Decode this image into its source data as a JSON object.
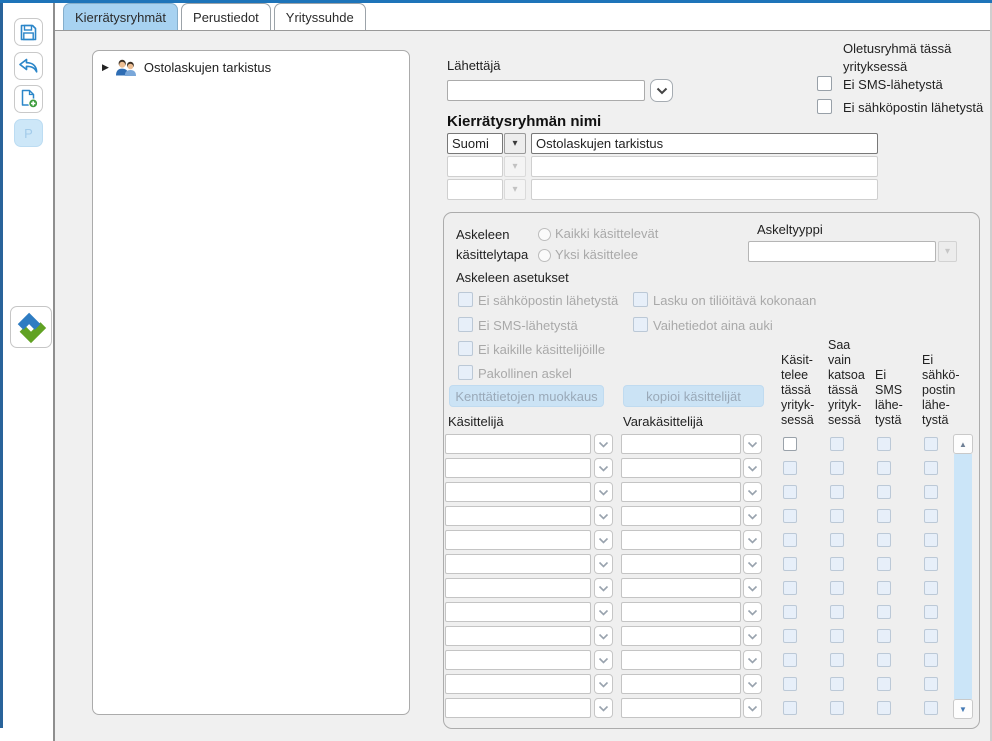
{
  "colors": {
    "accent_blue": "#1E74B9",
    "left_strip_blue": "#29639A",
    "tab_active_blue": "#A7D2F1",
    "panel_button_blue": "#CBE3F5",
    "scrollbar_track_blue": "#CBE5F8",
    "icon_blue": "#2B86C9",
    "logo_green": "#61A223"
  },
  "icons": {
    "save": "floppy-disk",
    "undo": "undo-arrow",
    "new_document": "document-with-plus",
    "logo": "app-logo-interlocked-check",
    "tree_item": "two-people-group",
    "dropdowns": "chevron-down",
    "scroll": "triangle-up-down"
  },
  "sidebar": {
    "p_button_label": "P"
  },
  "tabs": [
    {
      "label": "Kierrätysryhmät",
      "active": true
    },
    {
      "label": "Perustiedot",
      "active": false
    },
    {
      "label": "Yrityssuhde",
      "active": false
    }
  ],
  "tree": {
    "items": [
      {
        "label": "Ostolaskujen tarkistus",
        "expanded": false
      }
    ]
  },
  "form": {
    "sender_label": "Lähettäjä",
    "sender_value": "",
    "default_group_label": "Oletusryhmä tässä\nyrityksessä",
    "default_group_checks": [
      {
        "label": "Ei SMS-lähetystä",
        "checked": false
      },
      {
        "label": "Ei sähköpostin lähetystä",
        "checked": false
      }
    ],
    "group_name_heading": "Kierrätysryhmän nimi",
    "name_rows": [
      {
        "language": "Suomi",
        "value": "Ostolaskujen tarkistus",
        "enabled": true
      },
      {
        "language": "",
        "value": "",
        "enabled": false
      },
      {
        "language": "",
        "value": "",
        "enabled": false
      }
    ]
  },
  "step_panel": {
    "handling_label": "Askeleen\nkäsittelytapa",
    "handling_options": [
      {
        "label": "Kaikki käsittelevät",
        "selected": false
      },
      {
        "label": "Yksi käsittelee",
        "selected": false
      }
    ],
    "step_type_label": "Askeltyyppi",
    "step_type_value": "",
    "settings_label": "Askeleen asetukset",
    "settings_col1": [
      {
        "label": "Ei sähköpostin lähetystä",
        "checked": false,
        "enabled": false
      },
      {
        "label": "Ei SMS-lähetystä",
        "checked": false,
        "enabled": false
      },
      {
        "label": "Ei kaikille käsittelijöille",
        "checked": false,
        "enabled": false
      },
      {
        "label": "Pakollinen askel",
        "checked": false,
        "enabled": false
      }
    ],
    "settings_col2": [
      {
        "label": "Lasku on tiliöitävä kokonaan",
        "checked": false,
        "enabled": false
      },
      {
        "label": "Vaihetiedot aina auki",
        "checked": false,
        "enabled": false
      }
    ],
    "buttons": {
      "field_edit": "Kenttätietojen muokkaus",
      "copy_handlers": "kopioi käsittelijät"
    },
    "handler_label": "Käsittelijä",
    "deputy_label": "Varakäsittelijä",
    "check_columns": [
      "Käsit-\ntelee\ntässä\nyrityk-\nsessä",
      "Saa\nvain\nkatsoa\ntässä\nyrityk-\nsessä",
      "Ei\nSMS\nlähe-\ntystä",
      "Ei\nsähkö-\npostin\nlähe-\ntystä"
    ],
    "rows": [
      {
        "handler": "",
        "deputy": "",
        "checks": [
          {
            "editable": true,
            "checked": false
          },
          {
            "editable": false,
            "checked": false
          },
          {
            "editable": false,
            "checked": false
          },
          {
            "editable": false,
            "checked": false
          }
        ]
      },
      {
        "handler": "",
        "deputy": "",
        "checks": [
          {
            "editable": false,
            "checked": false
          },
          {
            "editable": false,
            "checked": false
          },
          {
            "editable": false,
            "checked": false
          },
          {
            "editable": false,
            "checked": false
          }
        ]
      },
      {
        "handler": "",
        "deputy": "",
        "checks": [
          {
            "editable": false,
            "checked": false
          },
          {
            "editable": false,
            "checked": false
          },
          {
            "editable": false,
            "checked": false
          },
          {
            "editable": false,
            "checked": false
          }
        ]
      },
      {
        "handler": "",
        "deputy": "",
        "checks": [
          {
            "editable": false,
            "checked": false
          },
          {
            "editable": false,
            "checked": false
          },
          {
            "editable": false,
            "checked": false
          },
          {
            "editable": false,
            "checked": false
          }
        ]
      },
      {
        "handler": "",
        "deputy": "",
        "checks": [
          {
            "editable": false,
            "checked": false
          },
          {
            "editable": false,
            "checked": false
          },
          {
            "editable": false,
            "checked": false
          },
          {
            "editable": false,
            "checked": false
          }
        ]
      },
      {
        "handler": "",
        "deputy": "",
        "checks": [
          {
            "editable": false,
            "checked": false
          },
          {
            "editable": false,
            "checked": false
          },
          {
            "editable": false,
            "checked": false
          },
          {
            "editable": false,
            "checked": false
          }
        ]
      },
      {
        "handler": "",
        "deputy": "",
        "checks": [
          {
            "editable": false,
            "checked": false
          },
          {
            "editable": false,
            "checked": false
          },
          {
            "editable": false,
            "checked": false
          },
          {
            "editable": false,
            "checked": false
          }
        ]
      },
      {
        "handler": "",
        "deputy": "",
        "checks": [
          {
            "editable": false,
            "checked": false
          },
          {
            "editable": false,
            "checked": false
          },
          {
            "editable": false,
            "checked": false
          },
          {
            "editable": false,
            "checked": false
          }
        ]
      },
      {
        "handler": "",
        "deputy": "",
        "checks": [
          {
            "editable": false,
            "checked": false
          },
          {
            "editable": false,
            "checked": false
          },
          {
            "editable": false,
            "checked": false
          },
          {
            "editable": false,
            "checked": false
          }
        ]
      },
      {
        "handler": "",
        "deputy": "",
        "checks": [
          {
            "editable": false,
            "checked": false
          },
          {
            "editable": false,
            "checked": false
          },
          {
            "editable": false,
            "checked": false
          },
          {
            "editable": false,
            "checked": false
          }
        ]
      },
      {
        "handler": "",
        "deputy": "",
        "checks": [
          {
            "editable": false,
            "checked": false
          },
          {
            "editable": false,
            "checked": false
          },
          {
            "editable": false,
            "checked": false
          },
          {
            "editable": false,
            "checked": false
          }
        ]
      },
      {
        "handler": "",
        "deputy": "",
        "checks": [
          {
            "editable": false,
            "checked": false
          },
          {
            "editable": false,
            "checked": false
          },
          {
            "editable": false,
            "checked": false
          },
          {
            "editable": false,
            "checked": false
          }
        ]
      }
    ]
  }
}
